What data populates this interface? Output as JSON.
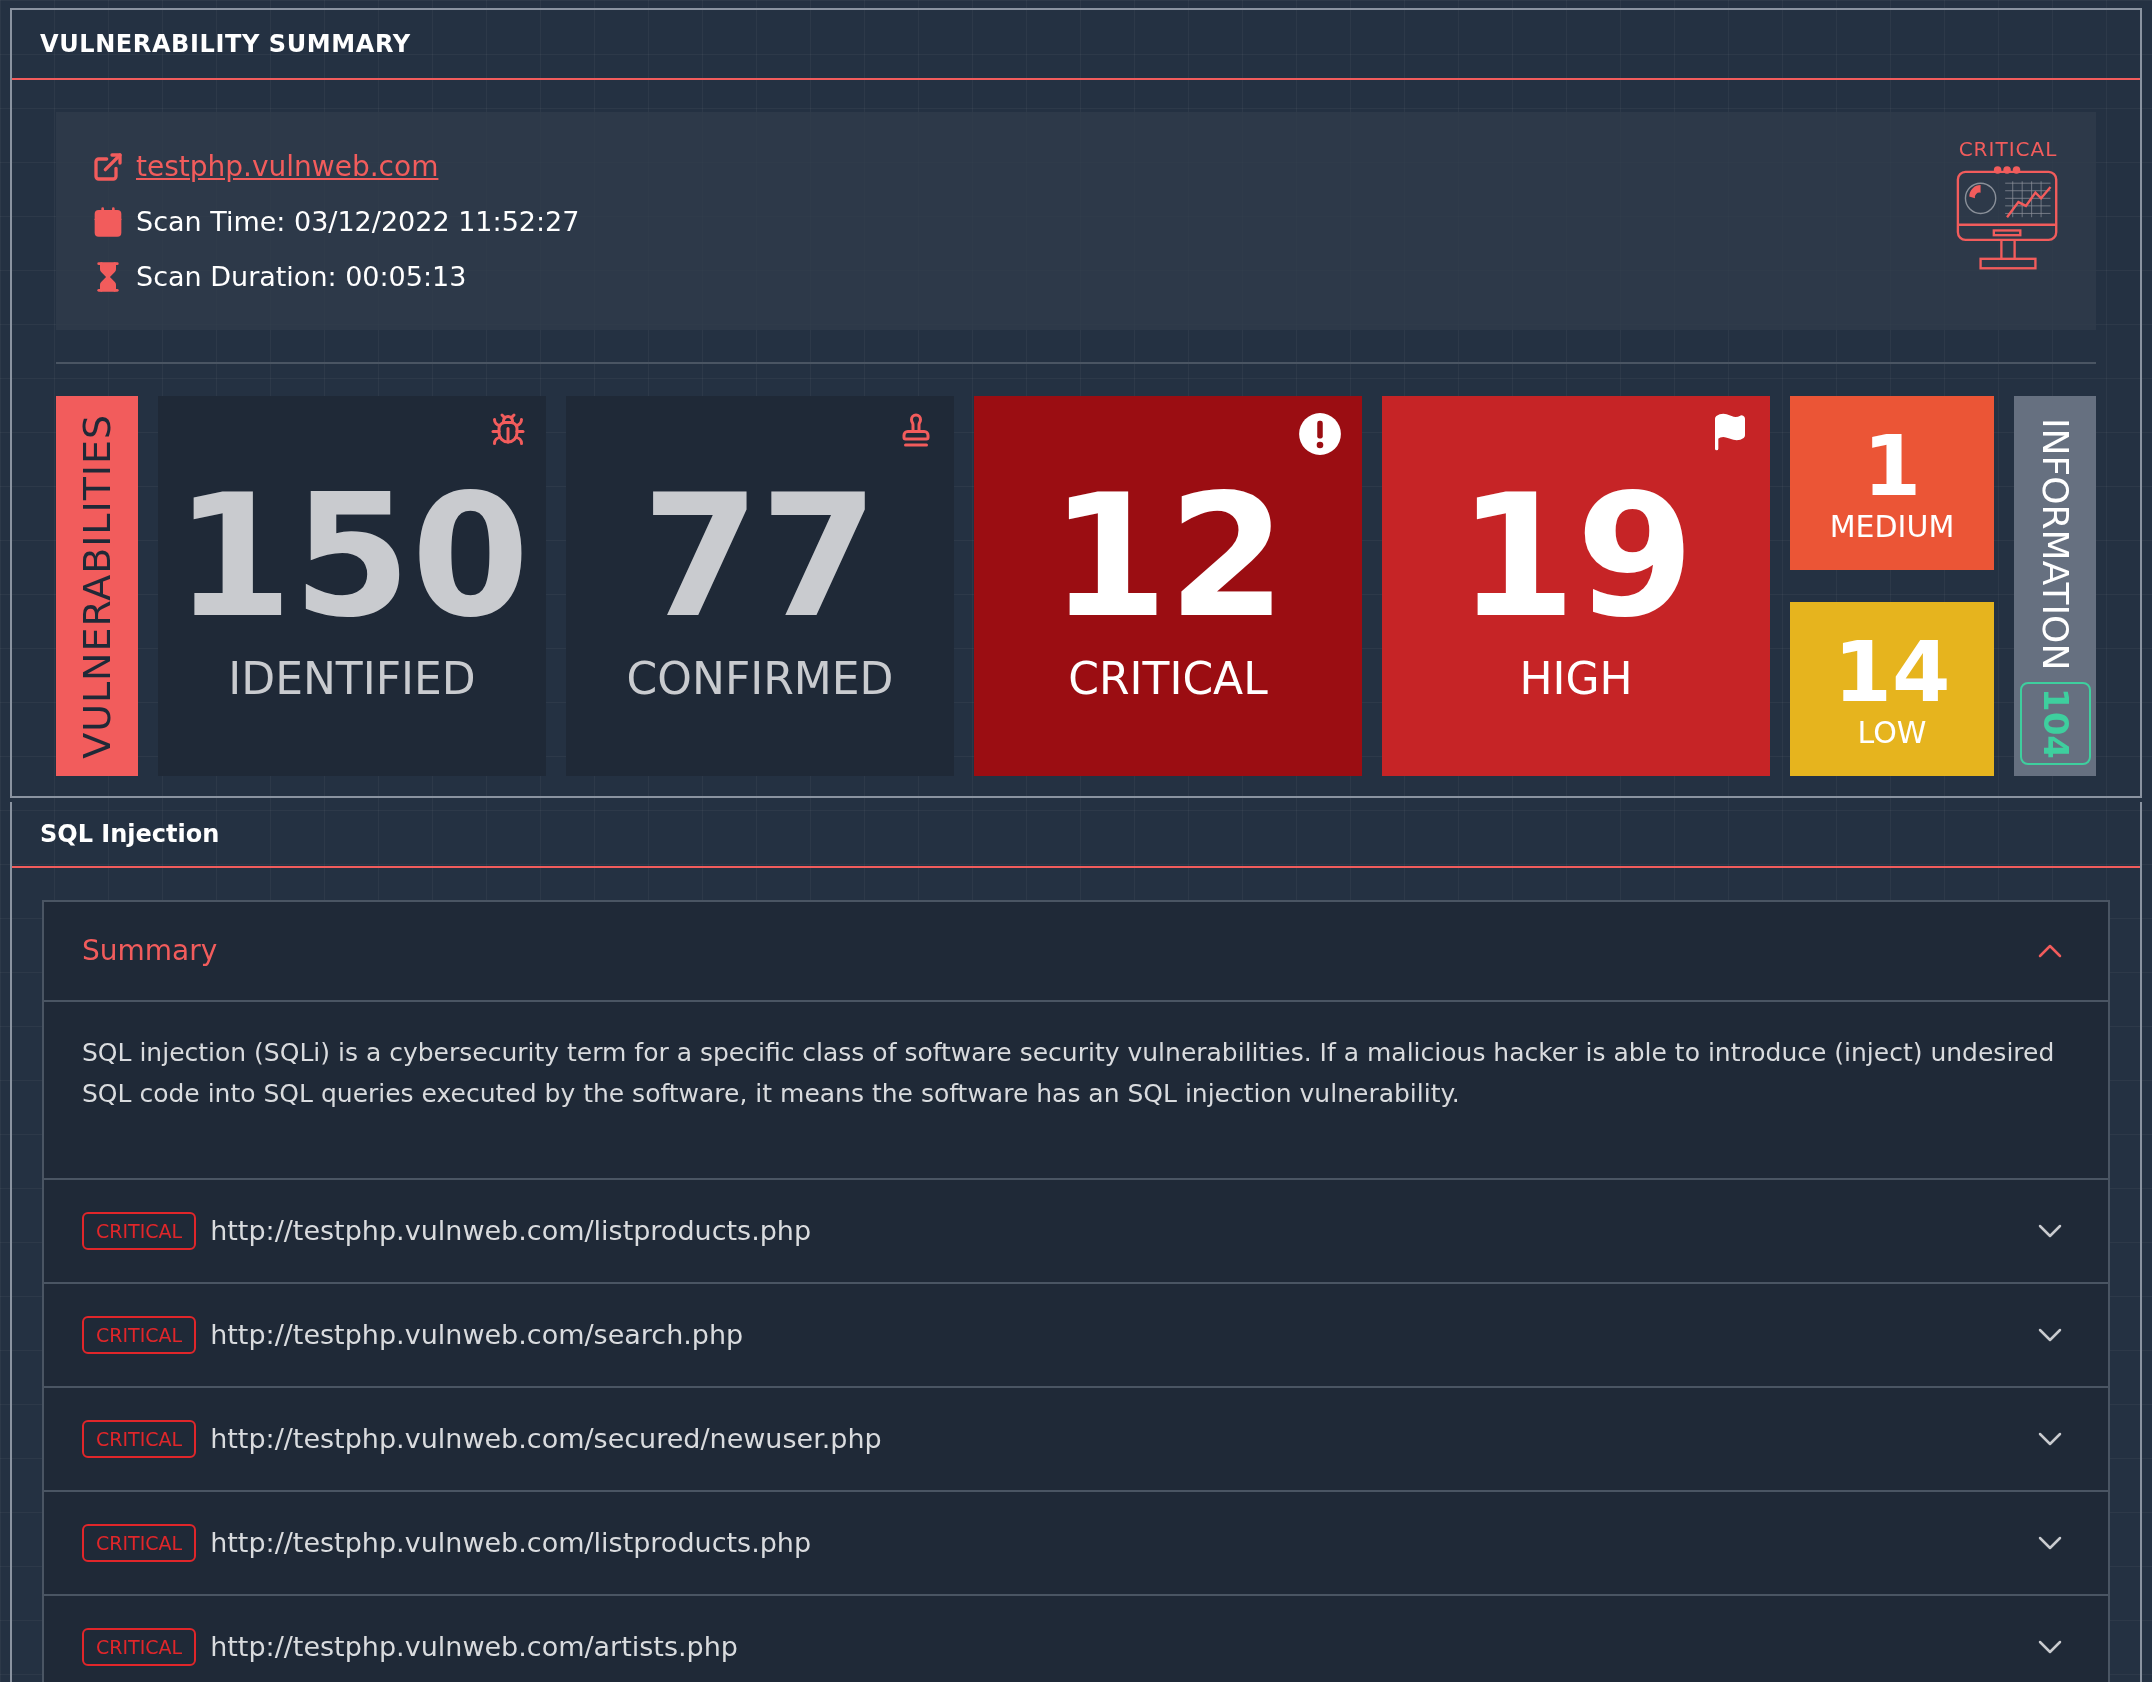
{
  "summary_panel": {
    "title": "VULNERABILITY SUMMARY",
    "target_link": "testphp.vulnweb.com",
    "scan_time": "Scan Time: 03/12/2022 11:52:27",
    "scan_duration": "Scan Duration: 00:05:13",
    "threat_level": "CRITICAL"
  },
  "vulnerabilities": {
    "label": "VULNERABILITIES",
    "tiles": [
      {
        "kind": "identified",
        "value": "150",
        "label": "IDENTIFIED"
      },
      {
        "kind": "confirmed",
        "value": "77",
        "label": "CONFIRMED"
      },
      {
        "kind": "critical",
        "value": "12",
        "label": "CRITICAL"
      },
      {
        "kind": "high",
        "value": "19",
        "label": "HIGH"
      },
      {
        "kind": "medium",
        "value": "1",
        "label": "MEDIUM"
      },
      {
        "kind": "low",
        "value": "14",
        "label": "LOW"
      }
    ],
    "information": {
      "label": "INFORMATION",
      "count": "104"
    }
  },
  "section": {
    "title": "SQL Injection",
    "summary": {
      "title": "Summary",
      "expanded": true,
      "text": "SQL injection (SQLi) is a cybersecurity term for a specific class of software security vulnerabilities. If a malicious hacker is able to introduce (inject) undesired SQL code into SQL queries executed by the software, it means the software has an SQL injection vulnerability."
    },
    "findings": [
      {
        "severity": "CRITICAL",
        "url": "http://testphp.vulnweb.com/listproducts.php",
        "expanded": false
      },
      {
        "severity": "CRITICAL",
        "url": "http://testphp.vulnweb.com/search.php",
        "expanded": false
      },
      {
        "severity": "CRITICAL",
        "url": "http://testphp.vulnweb.com/secured/newuser.php",
        "expanded": false
      },
      {
        "severity": "CRITICAL",
        "url": "http://testphp.vulnweb.com/listproducts.php",
        "expanded": false
      },
      {
        "severity": "CRITICAL",
        "url": "http://testphp.vulnweb.com/artists.php",
        "expanded": false
      }
    ]
  }
}
